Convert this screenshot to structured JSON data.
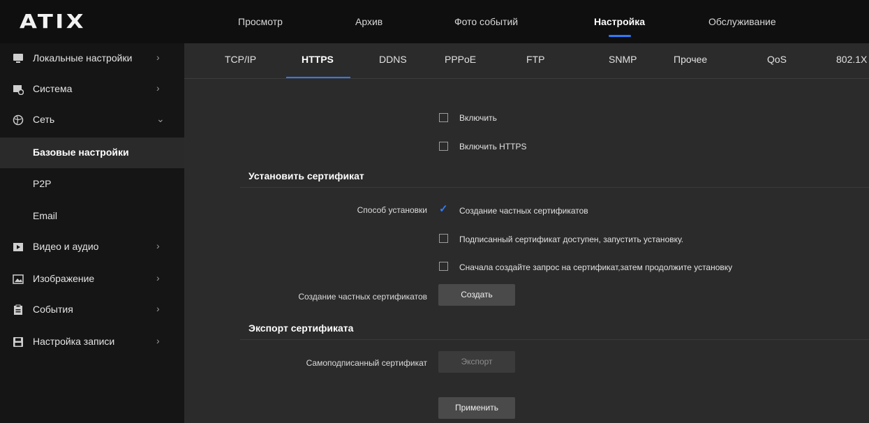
{
  "app": {
    "logo": "ATIX"
  },
  "topnav": [
    {
      "label": "Просмотр"
    },
    {
      "label": "Архив"
    },
    {
      "label": "Фото событий"
    },
    {
      "label": "Настройка",
      "active": true
    },
    {
      "label": "Обслуживание"
    }
  ],
  "sidebar": {
    "items": [
      {
        "label": "Локальные настройки",
        "chevron": "›"
      },
      {
        "label": "Система",
        "chevron": "›"
      },
      {
        "label": "Сеть",
        "chevron": "⌄"
      },
      {
        "label": "Базовые настройки",
        "active": true
      },
      {
        "label": "P2P"
      },
      {
        "label": "Email"
      },
      {
        "label": "Видео и аудио",
        "chevron": "›"
      },
      {
        "label": "Изображение",
        "chevron": "›"
      },
      {
        "label": "События",
        "chevron": "›"
      },
      {
        "label": "Настройка записи",
        "chevron": "›"
      }
    ]
  },
  "tabs": [
    {
      "label": "TCP/IP"
    },
    {
      "label": "HTTPS",
      "active": true
    },
    {
      "label": "DDNS"
    },
    {
      "label": "PPPoE"
    },
    {
      "label": "FTP"
    },
    {
      "label": "SNMP"
    },
    {
      "label": "Прочее"
    },
    {
      "label": "QoS"
    },
    {
      "label": "802.1X"
    }
  ],
  "form": {
    "enable": {
      "label": "Включить",
      "checked": false
    },
    "enable_https": {
      "label": "Включить HTTPS",
      "checked": false
    },
    "install_section_title": "Установить сертификат",
    "install_method_label": "Способ установки",
    "install_options": [
      {
        "label": "Создание частных сертификатов",
        "checked": true
      },
      {
        "label": "Подписанный сертификат доступен, запустить установку.",
        "checked": false
      },
      {
        "label": "Сначала создайте запрос на сертификат,затем продолжите установку",
        "checked": false
      }
    ],
    "create_private_label": "Создание частных сертификатов",
    "create_button": "Создать",
    "export_section_title": "Экспорт сертификата",
    "self_signed_label": "Самоподписанный сертификат",
    "export_button": "Экспорт",
    "apply_button": "Применить"
  },
  "colors": {
    "accent": "#2e7bff",
    "topbar": "#0f0f0f",
    "sidebar": "#151515",
    "content": "#2b2b2b"
  }
}
